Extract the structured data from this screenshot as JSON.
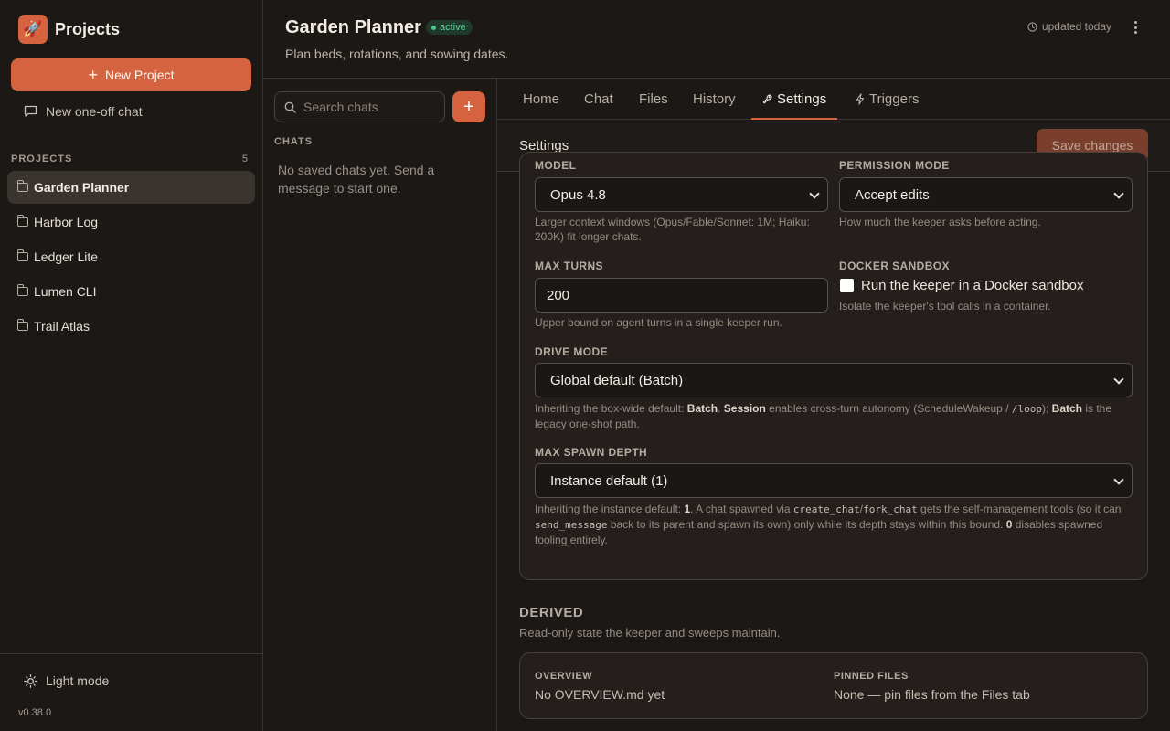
{
  "sidebar": {
    "brand_title": "Projects",
    "new_project_label": "New Project",
    "oneoff_label": "New one-off chat",
    "projects_heading": "PROJECTS",
    "projects_count": "5",
    "projects": [
      {
        "name": "Garden Planner"
      },
      {
        "name": "Harbor Log"
      },
      {
        "name": "Ledger Lite"
      },
      {
        "name": "Lumen CLI"
      },
      {
        "name": "Trail Atlas"
      }
    ],
    "light_mode_label": "Light mode",
    "version": "v0.38.0"
  },
  "header": {
    "title": "Garden Planner",
    "status": "active",
    "subtitle": "Plan beds, rotations, and sowing dates.",
    "updated": "updated today"
  },
  "chats": {
    "search_placeholder": "Search chats",
    "heading": "CHATS",
    "empty_text": "No saved chats yet. Send a message to start one."
  },
  "tabs": [
    {
      "label": "Home"
    },
    {
      "label": "Chat"
    },
    {
      "label": "Files"
    },
    {
      "label": "History"
    },
    {
      "label": "Settings",
      "icon": "wrench-icon"
    },
    {
      "label": "Triggers",
      "icon": "bolt-icon"
    }
  ],
  "settings": {
    "title": "Settings",
    "save_label": "Save changes",
    "model": {
      "label": "MODEL",
      "value": "Opus 4.8",
      "help": "Larger context windows (Opus/Fable/Sonnet: 1M; Haiku: 200K) fit longer chats."
    },
    "permission": {
      "label": "PERMISSION MODE",
      "value": "Accept edits",
      "help": "How much the keeper asks before acting."
    },
    "max_turns": {
      "label": "MAX TURNS",
      "value": "200",
      "help": "Upper bound on agent turns in a single keeper run."
    },
    "docker": {
      "label": "DOCKER SANDBOX",
      "checkbox_label": "Run the keeper in a Docker sandbox",
      "help": "Isolate the keeper's tool calls in a container."
    },
    "drive_mode": {
      "label": "DRIVE MODE",
      "value": "Global default (Batch)",
      "help_prefix": "Inheriting the box-wide default: ",
      "help_b1": "Batch",
      "help_mid1": ". ",
      "help_b2": "Session",
      "help_mid2": " enables cross-turn autonomy (ScheduleWakeup / ",
      "help_code": "/loop",
      "help_mid3": "); ",
      "help_b3": "Batch",
      "help_suffix": " is the legacy one-shot path."
    },
    "spawn_depth": {
      "label": "MAX SPAWN DEPTH",
      "value": "Instance default (1)",
      "help_prefix": "Inheriting the instance default: ",
      "help_b1": "1",
      "help_mid1": ". A chat spawned via ",
      "help_code1": "create_chat",
      "help_slash": "/",
      "help_code2": "fork_chat",
      "help_mid2": " gets the self-management tools (so it can ",
      "help_code3": "send_message",
      "help_mid3": " back to its parent and spawn its own) only while its depth stays within this bound. ",
      "help_b2": "0",
      "help_suffix": " disables spawned tooling entirely."
    }
  },
  "derived": {
    "title": "DERIVED",
    "subtitle": "Read-only state the keeper and sweeps maintain.",
    "overview_label": "OVERVIEW",
    "overview_value": "No OVERVIEW.md yet",
    "pinned_label": "PINNED FILES",
    "pinned_value": "None — pin files from the Files tab"
  },
  "colors": {
    "accent": "#d5633f",
    "background": "#1b1816",
    "status_green": "#5fd39a"
  }
}
